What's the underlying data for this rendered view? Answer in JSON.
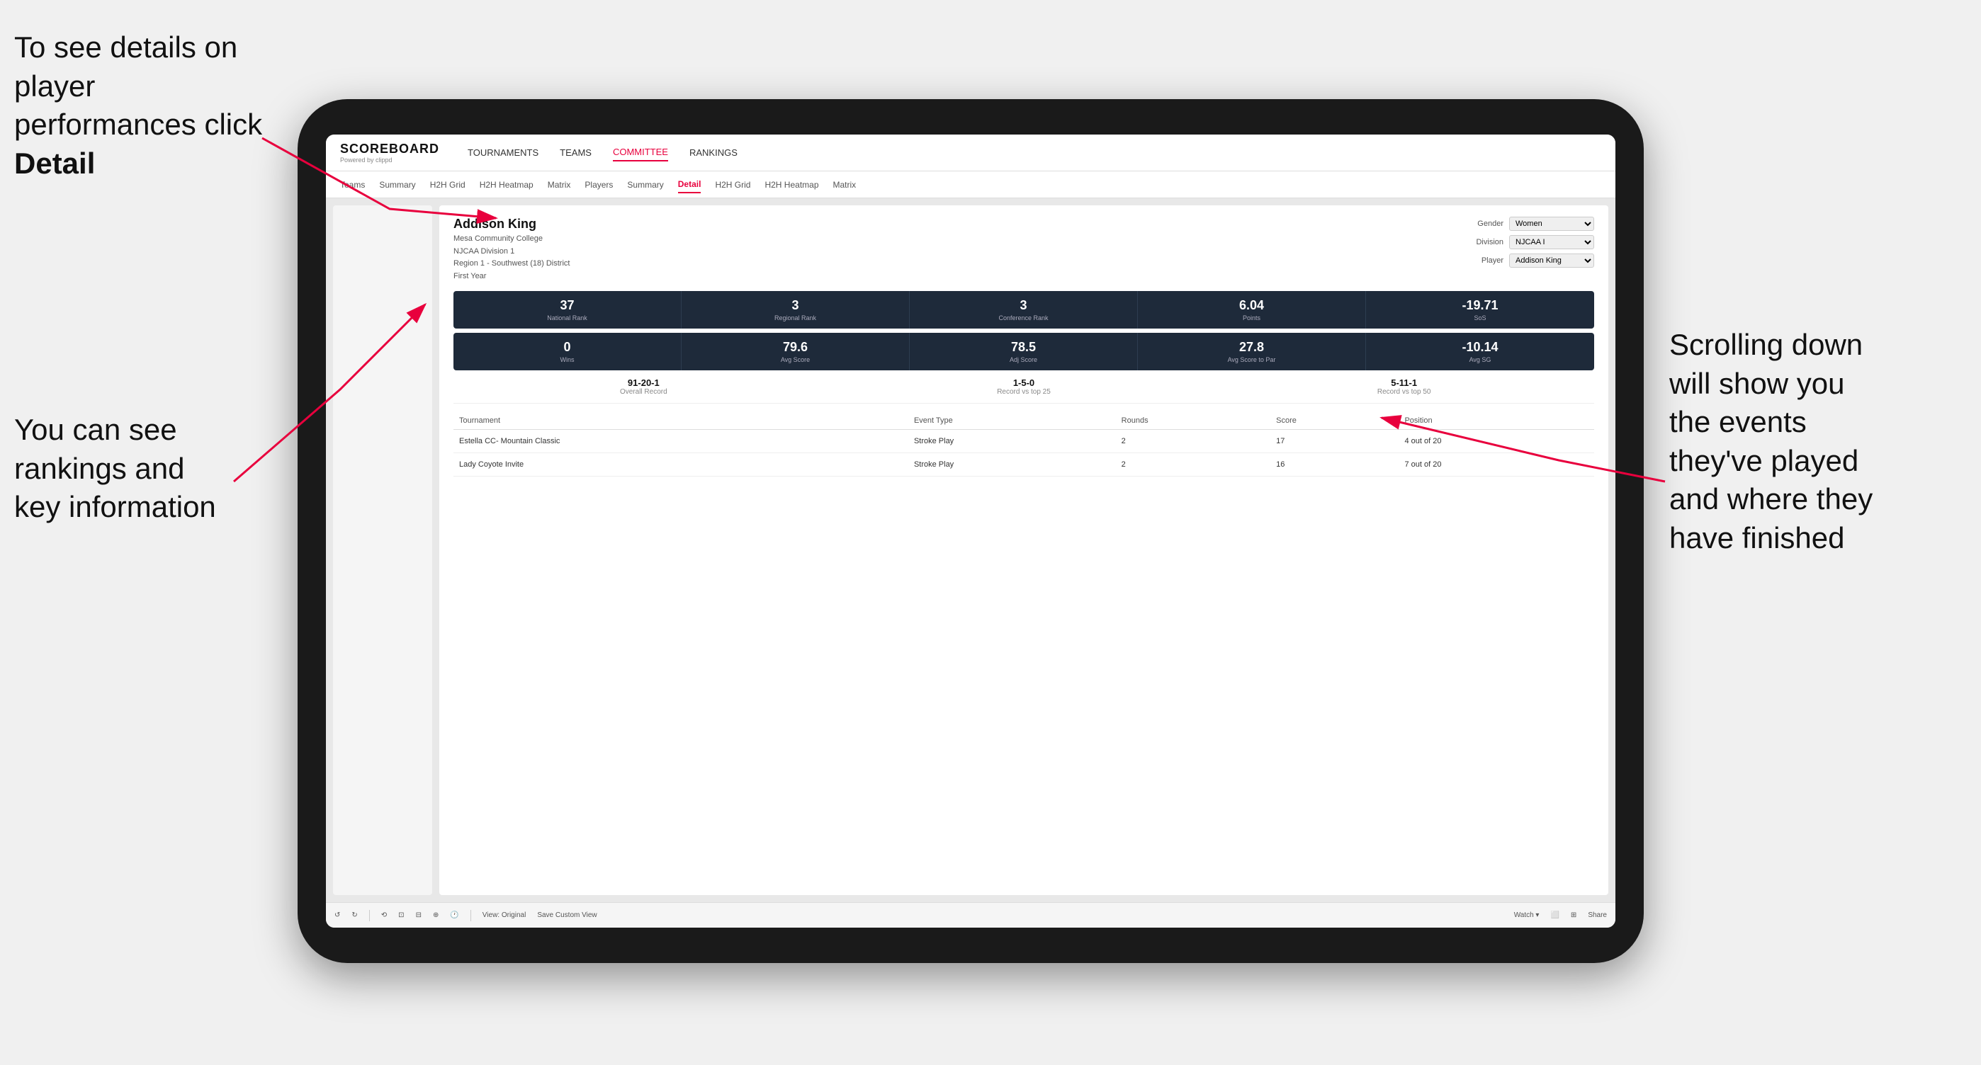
{
  "annotations": {
    "topleft": "To see details on player performances click",
    "topleft_bold": "Detail",
    "bottomleft_line1": "You can see",
    "bottomleft_line2": "rankings and",
    "bottomleft_line3": "key information",
    "right_line1": "Scrolling down",
    "right_line2": "will show you",
    "right_line3": "the events",
    "right_line4": "they've played",
    "right_line5": "and where they",
    "right_line6": "have finished"
  },
  "nav": {
    "logo": "SCOREBOARD",
    "logo_sub": "Powered by clippd",
    "links": [
      "TOURNAMENTS",
      "TEAMS",
      "COMMITTEE",
      "RANKINGS"
    ],
    "active_link": "COMMITTEE"
  },
  "subnav": {
    "links": [
      "Teams",
      "Summary",
      "H2H Grid",
      "H2H Heatmap",
      "Matrix",
      "Players",
      "Summary",
      "Detail",
      "H2H Grid",
      "H2H Heatmap",
      "Matrix"
    ],
    "active_link": "Detail"
  },
  "player": {
    "name": "Addison King",
    "college": "Mesa Community College",
    "division": "NJCAA Division 1",
    "region": "Region 1 - Southwest (18) District",
    "year": "First Year",
    "gender_label": "Gender",
    "gender_value": "Women",
    "division_label": "Division",
    "division_value": "NJCAA I",
    "player_label": "Player",
    "player_value": "Addison King"
  },
  "stats_row1": [
    {
      "value": "37",
      "label": "National Rank"
    },
    {
      "value": "3",
      "label": "Regional Rank"
    },
    {
      "value": "3",
      "label": "Conference Rank"
    },
    {
      "value": "6.04",
      "label": "Points"
    },
    {
      "value": "-19.71",
      "label": "SoS"
    }
  ],
  "stats_row2": [
    {
      "value": "0",
      "label": "Wins"
    },
    {
      "value": "79.6",
      "label": "Avg Score"
    },
    {
      "value": "78.5",
      "label": "Adj Score"
    },
    {
      "value": "27.8",
      "label": "Avg Score to Par"
    },
    {
      "value": "-10.14",
      "label": "Avg SG"
    }
  ],
  "records": [
    {
      "value": "91-20-1",
      "label": "Overall Record"
    },
    {
      "value": "1-5-0",
      "label": "Record vs top 25"
    },
    {
      "value": "5-11-1",
      "label": "Record vs top 50"
    }
  ],
  "table": {
    "headers": [
      "Tournament",
      "Event Type",
      "Rounds",
      "Score",
      "Position"
    ],
    "rows": [
      {
        "tournament": "Estella CC- Mountain Classic",
        "event_type": "Stroke Play",
        "rounds": "2",
        "score": "17",
        "position": "4 out of 20"
      },
      {
        "tournament": "Lady Coyote Invite",
        "event_type": "Stroke Play",
        "rounds": "2",
        "score": "16",
        "position": "7 out of 20"
      }
    ]
  },
  "toolbar": {
    "buttons": [
      "↺",
      "↻",
      "⟲",
      "⊡",
      "⊟",
      "⊕",
      "⊖",
      "🕐"
    ],
    "view_label": "View: Original",
    "save_label": "Save Custom View",
    "watch_label": "Watch ▾",
    "share_label": "Share"
  }
}
